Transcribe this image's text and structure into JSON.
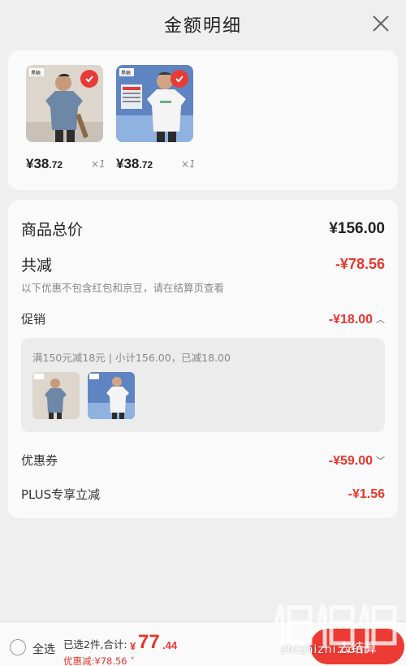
{
  "header": {
    "title": "金额明细",
    "close_icon": "close-icon"
  },
  "products": [
    {
      "price_int": "¥38",
      "price_dec": ".72",
      "qty": "×1",
      "selected": true
    },
    {
      "price_int": "¥38",
      "price_dec": ".72",
      "qty": "×1",
      "selected": true
    }
  ],
  "summary": {
    "total_label": "商品总价",
    "total_value": "¥156.00",
    "reduce_label": "共减",
    "reduce_value": "-¥78.56",
    "note": "以下优惠不包含红包和京豆，请在结算页查看"
  },
  "promo": {
    "label": "促销",
    "value": "-¥18.00",
    "detail": "满150元减18元 | 小计156.00，已减18.00"
  },
  "coupon": {
    "label": "优惠券",
    "value": "-¥59.00"
  },
  "plus": {
    "label": "PLUS专享立减",
    "value": "-¥1.56"
  },
  "bottom": {
    "select_all": "全选",
    "selected_summary": "已选2件,合计:",
    "total_yen": "¥",
    "total_int": "77",
    "total_dec": ".44",
    "discount": "优惠减:¥78.56",
    "checkout": "去结算"
  },
  "watermark": {
    "text": "zhizhizhi.com"
  },
  "colors": {
    "accent": "#e8362f",
    "page_bg": "#efefef",
    "card_bg": "#fafafa"
  }
}
